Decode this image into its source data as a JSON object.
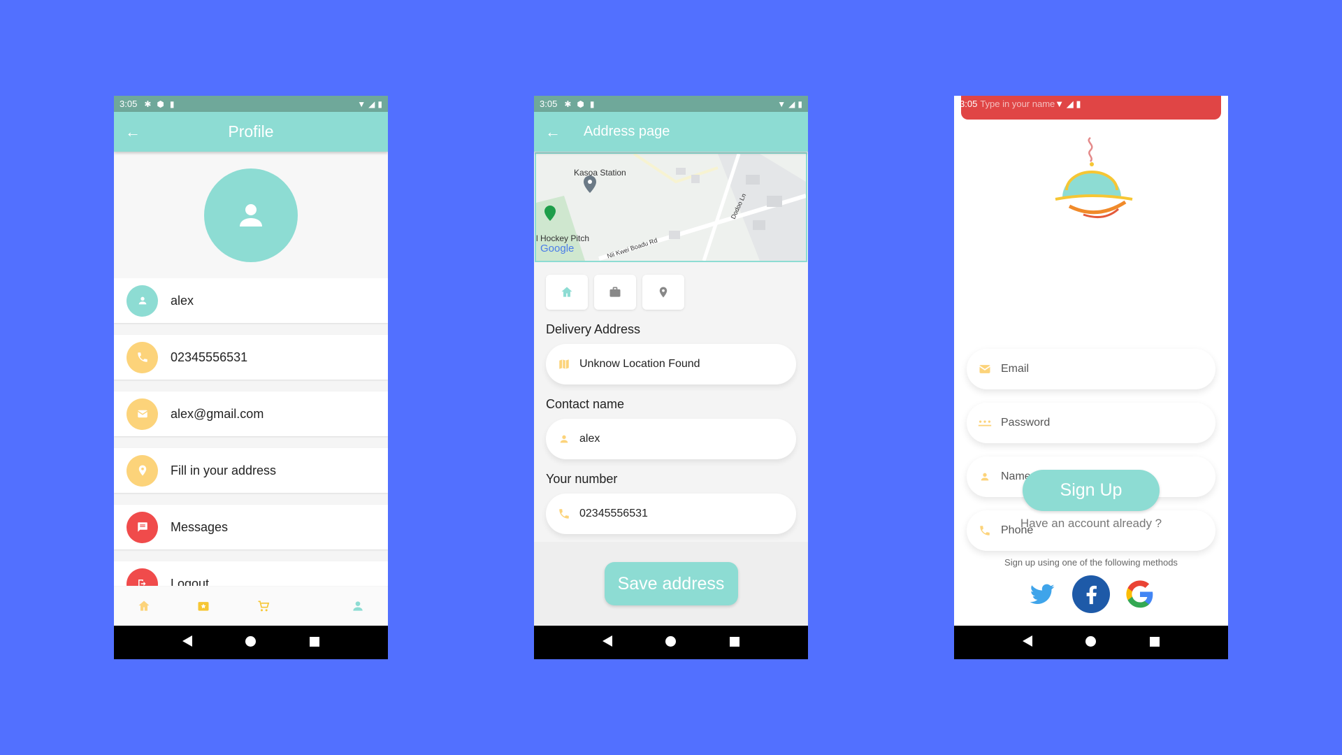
{
  "status": {
    "time": "3:05"
  },
  "profile": {
    "title": "Profile",
    "items": [
      {
        "label": "alex",
        "icon": "person-icon",
        "color": "#8ddcd3"
      },
      {
        "label": "02345556531",
        "icon": "phone-icon",
        "color": "#fcd37a"
      },
      {
        "label": "alex@gmail.com",
        "icon": "mail-icon",
        "color": "#fcd37a"
      },
      {
        "label": "Fill in your address",
        "icon": "location-icon",
        "color": "#fcd37a"
      },
      {
        "label": "Messages",
        "icon": "message-icon",
        "color": "#f04b4b"
      },
      {
        "label": "Logout",
        "icon": "logout-icon",
        "color": "#f04b4b"
      }
    ],
    "tabs": [
      "home-icon",
      "offers-icon",
      "cart-icon",
      "profile-icon"
    ]
  },
  "address": {
    "title": "Address page",
    "map_labels": {
      "station": "Kasoa Station",
      "pitch": "l Hockey Pitch",
      "road1": "Nii Kwei Boadu Rd",
      "road2": "Dodoo Ln",
      "brand": "Google"
    },
    "delivery_label": "Delivery Address",
    "delivery_value": "Unknow Location Found",
    "contact_label": "Contact name",
    "contact_value": "alex",
    "number_label": "Your number",
    "number_value": "02345556531",
    "save_label": "Save address"
  },
  "signup": {
    "toast_text": "Type in your name",
    "email_placeholder": "Email",
    "password_placeholder": "Password",
    "name_placeholder": "Name",
    "phone_placeholder": "Phone",
    "button_label": "Sign Up",
    "have_account": "Have an account already ?",
    "methods_text": "Sign up using one of the following methods"
  },
  "colors": {
    "background": "#5270FF",
    "accent": "#8ddcd3",
    "yellow": "#fcd37a",
    "red": "#f04b4b"
  }
}
